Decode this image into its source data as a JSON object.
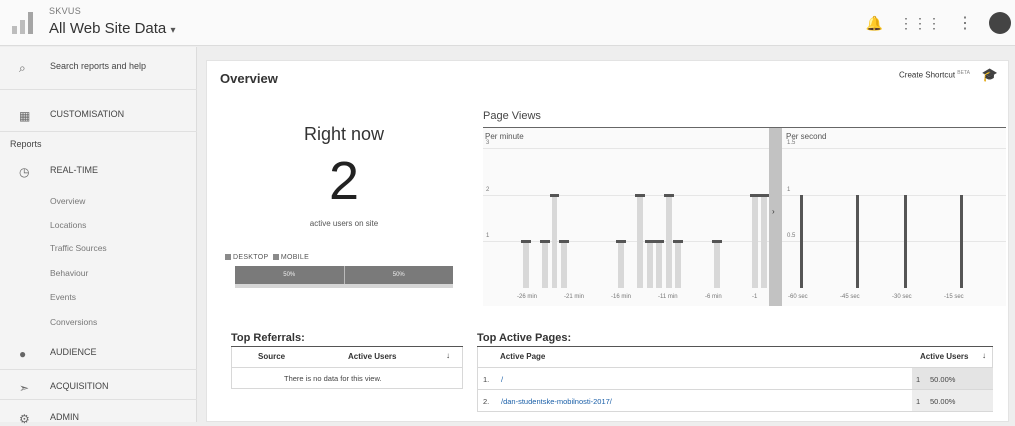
{
  "header": {
    "account_small": "SKVUS",
    "account_main": "All Web Site Data",
    "icons": [
      "notification-bell-icon",
      "apps-grid-icon",
      "more-vert-icon",
      "avatar"
    ]
  },
  "sidebar": {
    "search_label": "Search reports and help",
    "customisation_label": "CUSTOMISATION",
    "reports_label": "Reports",
    "realtime_label": "REAL-TIME",
    "realtime_items": [
      "Overview",
      "Locations",
      "Traffic Sources",
      "Behaviour",
      "Events",
      "Conversions"
    ],
    "audience_label": "AUDIENCE",
    "acquisition_label": "ACQUISITION",
    "admin_label": "ADMIN"
  },
  "main": {
    "title": "Overview",
    "create_shortcut": "Create Shortcut",
    "beta": "BETA"
  },
  "right_now": {
    "title": "Right now",
    "count": "2",
    "label": "active users on site",
    "legend_desktop": "DESKTOP",
    "legend_mobile": "MOBILE",
    "desktop_pct": "50%",
    "mobile_pct": "50%",
    "desktop_fraction": 0.5
  },
  "page_views": {
    "title": "Page Views",
    "per_minute_label": "Per minute",
    "per_second_label": "Per second"
  },
  "chart_data": [
    {
      "type": "bar",
      "subtitle": "Per minute",
      "ylim": [
        0,
        3
      ],
      "yticks": [
        "3",
        "2",
        "1"
      ],
      "xtick_labels": [
        "-26 min",
        "-21 min",
        "-16 min",
        "-11 min",
        "-6 min",
        "-1"
      ],
      "x": [
        -30,
        -29,
        -28,
        -27,
        -26,
        -25,
        -24,
        -23,
        -22,
        -21,
        -20,
        -19,
        -18,
        -17,
        -16,
        -15,
        -14,
        -13,
        -12,
        -11,
        -10,
        -9,
        -8,
        -7,
        -6,
        -5,
        -4,
        -3,
        -2,
        -1
      ],
      "values": [
        0,
        0,
        0,
        0,
        1,
        0,
        1,
        2,
        1,
        0,
        0,
        0,
        0,
        0,
        1,
        0,
        2,
        1,
        1,
        2,
        1,
        0,
        0,
        0,
        1,
        0,
        0,
        0,
        2,
        2
      ]
    },
    {
      "type": "bar",
      "subtitle": "Per second",
      "ylim": [
        0,
        1.5
      ],
      "yticks": [
        "1.5",
        "1",
        "0.5"
      ],
      "xtick_labels": [
        "-60 sec",
        "-45 sec",
        "-30 sec",
        "-15 sec"
      ],
      "x": [
        -60,
        -45,
        -30,
        -15
      ],
      "values": [
        0,
        0,
        0,
        0
      ],
      "spikes_x": [
        -57,
        -41,
        -27,
        -11
      ],
      "spikes_values": [
        1,
        1,
        1,
        1
      ]
    }
  ],
  "top_referrals": {
    "title": "Top Referrals:",
    "col_source": "Source",
    "col_active": "Active Users",
    "sort_icon": "arrow-down-icon",
    "empty_text": "There is no data for this view."
  },
  "top_pages": {
    "title": "Top Active Pages:",
    "col_page": "Active Page",
    "col_active": "Active Users",
    "sort_icon": "arrow-down-icon",
    "rows": [
      {
        "num": "1.",
        "page": "/",
        "users": "1",
        "pct": "50.00%"
      },
      {
        "num": "2.",
        "page": "/dan-studentske-mobilnosti-2017/",
        "users": "1",
        "pct": "50.00%"
      }
    ]
  }
}
